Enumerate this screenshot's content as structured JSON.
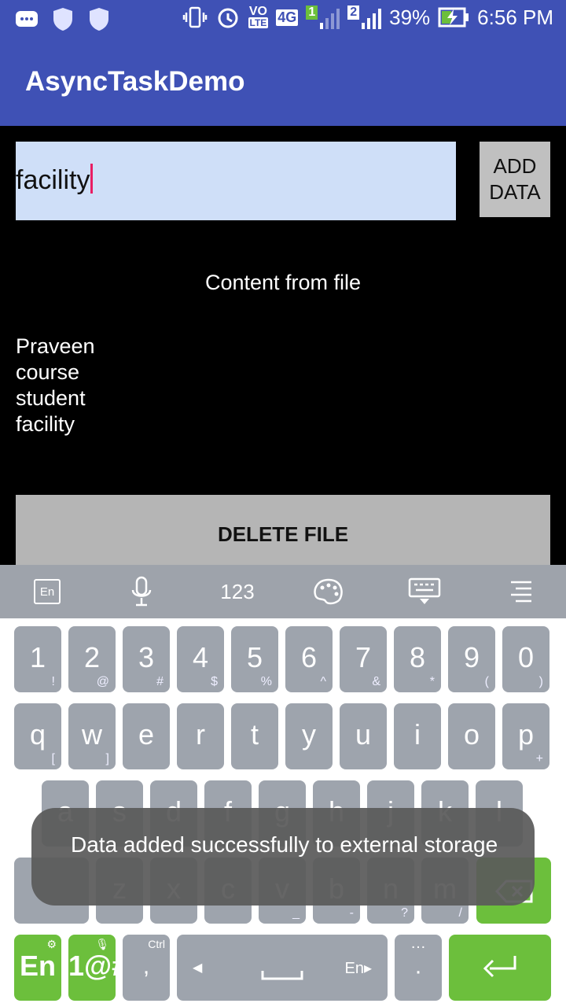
{
  "status_bar": {
    "battery_percent": "39%",
    "time": "6:56 PM",
    "network_labels": [
      "VO",
      "LTE",
      "4G",
      "1",
      "2"
    ],
    "icons": [
      "message-icon",
      "shield-icon",
      "shield-icon",
      "vibrate-icon",
      "alarm-icon",
      "volte-icon",
      "signal-icon",
      "signal-icon",
      "battery-charging-icon"
    ]
  },
  "app_bar": {
    "title": "AsyncTaskDemo"
  },
  "input": {
    "value": "facility"
  },
  "add_button": {
    "label_line1": "ADD",
    "label_line2": "DATA"
  },
  "content": {
    "title": "Content from file",
    "lines": [
      "Praveen",
      "course",
      "student",
      "facility"
    ]
  },
  "delete_button": {
    "label": "DELETE FILE"
  },
  "keyboard_toolbar": {
    "language_label": "En",
    "numbers_label": "123",
    "icons": [
      "language-icon",
      "microphone-icon",
      "palette-icon",
      "hide-keyboard-icon",
      "menu-icon"
    ]
  },
  "keyboard": {
    "row1": [
      {
        "main": "1",
        "sub": "!"
      },
      {
        "main": "2",
        "sub": "@"
      },
      {
        "main": "3",
        "sub": "#"
      },
      {
        "main": "4",
        "sub": "$"
      },
      {
        "main": "5",
        "sub": "%"
      },
      {
        "main": "6",
        "sub": "^"
      },
      {
        "main": "7",
        "sub": "&"
      },
      {
        "main": "8",
        "sub": "*"
      },
      {
        "main": "9",
        "sub": "("
      },
      {
        "main": "0",
        "sub": ")"
      }
    ],
    "row2": [
      {
        "main": "q",
        "sub": "["
      },
      {
        "main": "w",
        "sub": "]"
      },
      {
        "main": "e",
        "sub": ""
      },
      {
        "main": "r",
        "sub": ""
      },
      {
        "main": "t",
        "sub": ""
      },
      {
        "main": "y",
        "sub": ""
      },
      {
        "main": "u",
        "sub": ""
      },
      {
        "main": "i",
        "sub": ""
      },
      {
        "main": "o",
        "sub": ""
      },
      {
        "main": "p",
        "sub": "+"
      }
    ],
    "row3": [
      {
        "main": "a",
        "sub": ""
      },
      {
        "main": "s",
        "sub": ""
      },
      {
        "main": "d",
        "sub": ""
      },
      {
        "main": "f",
        "sub": ""
      },
      {
        "main": "g",
        "sub": ""
      },
      {
        "main": "h",
        "sub": ""
      },
      {
        "main": "j",
        "sub": ""
      },
      {
        "main": "k",
        "sub": ""
      },
      {
        "main": "l",
        "sub": ""
      }
    ],
    "row4": [
      {
        "main": "z",
        "sub": ""
      },
      {
        "main": "x",
        "sub": ""
      },
      {
        "main": "c",
        "sub": ""
      },
      {
        "main": "v",
        "sub": "_"
      },
      {
        "main": "b",
        "sub": "-"
      },
      {
        "main": "n",
        "sub": "?"
      },
      {
        "main": "m",
        "sub": "/"
      }
    ],
    "bottom": {
      "lang_key": "En",
      "sym_key": "1@#",
      "ctrl_label": "Ctrl",
      "comma": ",",
      "space_lang": "En",
      "period": "."
    }
  },
  "toast": {
    "message": "Data added successfully to external storage"
  }
}
